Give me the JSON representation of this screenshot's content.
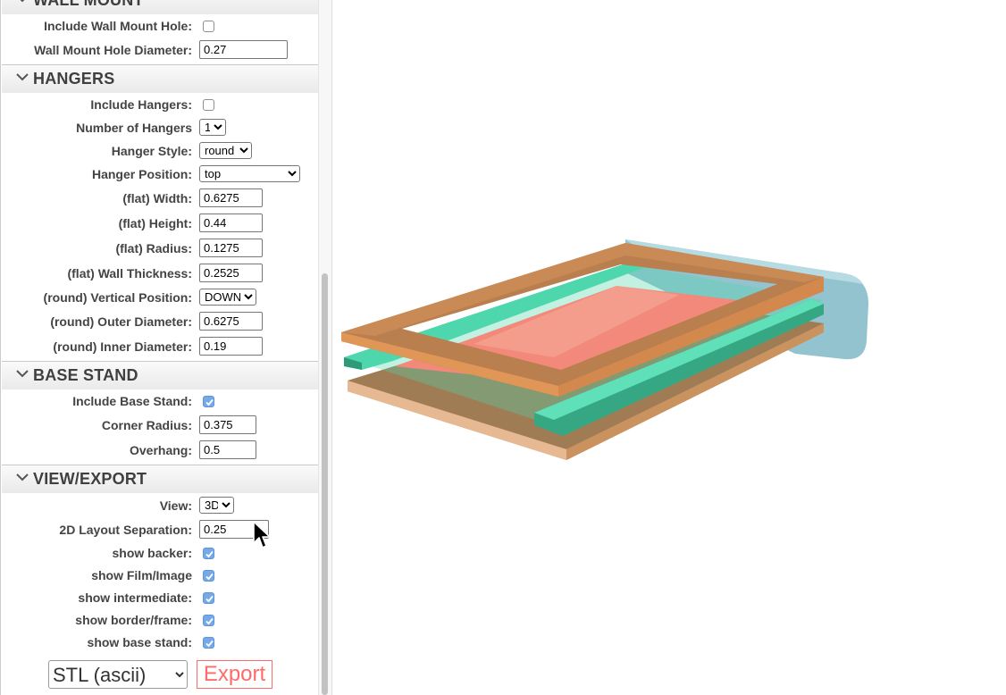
{
  "sections": {
    "wall_mount": {
      "title": "WALL MOUNT",
      "include_hole_label": "Include Wall Mount Hole:",
      "include_hole_checked": false,
      "hole_diameter_label": "Wall Mount Hole Diameter:",
      "hole_diameter_value": "0.27"
    },
    "hangers": {
      "title": "HANGERS",
      "include_label": "Include Hangers:",
      "include_checked": false,
      "number_label": "Number of Hangers",
      "number_value": "1",
      "style_label": "Hanger Style:",
      "style_value": "round",
      "position_label": "Hanger Position:",
      "position_value": "top",
      "flat_width_label": "(flat) Width:",
      "flat_width_value": "0.6275",
      "flat_height_label": "(flat) Height:",
      "flat_height_value": "0.44",
      "flat_radius_label": "(flat) Radius:",
      "flat_radius_value": "0.1275",
      "flat_wall_label": "(flat) Wall Thickness:",
      "flat_wall_value": "0.2525",
      "round_vpos_label": "(round) Vertical Position:",
      "round_vpos_value": "DOWN",
      "round_outer_label": "(round) Outer Diameter:",
      "round_outer_value": "0.6275",
      "round_inner_label": "(round) Inner Diameter:",
      "round_inner_value": "0.19"
    },
    "base_stand": {
      "title": "BASE STAND",
      "include_label": "Include Base Stand:",
      "include_checked": true,
      "corner_radius_label": "Corner Radius:",
      "corner_radius_value": "0.375",
      "overhang_label": "Overhang:",
      "overhang_value": "0.5"
    },
    "view_export": {
      "title": "VIEW/EXPORT",
      "view_label": "View:",
      "view_value": "3D",
      "separation_label": "2D Layout Separation:",
      "separation_value": "0.25",
      "show_backer_label": "show backer:",
      "show_backer_checked": true,
      "show_film_label": "show Film/Image",
      "show_film_checked": true,
      "show_intermediate_label": "show intermediate:",
      "show_intermediate_checked": true,
      "show_border_label": "show border/frame:",
      "show_border_checked": true,
      "show_base_label": "show base stand:",
      "show_base_checked": true,
      "export_format": "STL (ascii)",
      "export_button": "Export"
    }
  },
  "colors": {
    "frame": "#c98a56",
    "intermediate": "#5fdcb4",
    "film": "#f2897a",
    "backer": "#93c3cf",
    "base": "#d7a47c",
    "export_accent": "#ff6b6b",
    "checkbox_on": "#76a9e6"
  },
  "model_parts": [
    "backer",
    "base stand",
    "intermediate",
    "film/image",
    "border/frame"
  ]
}
